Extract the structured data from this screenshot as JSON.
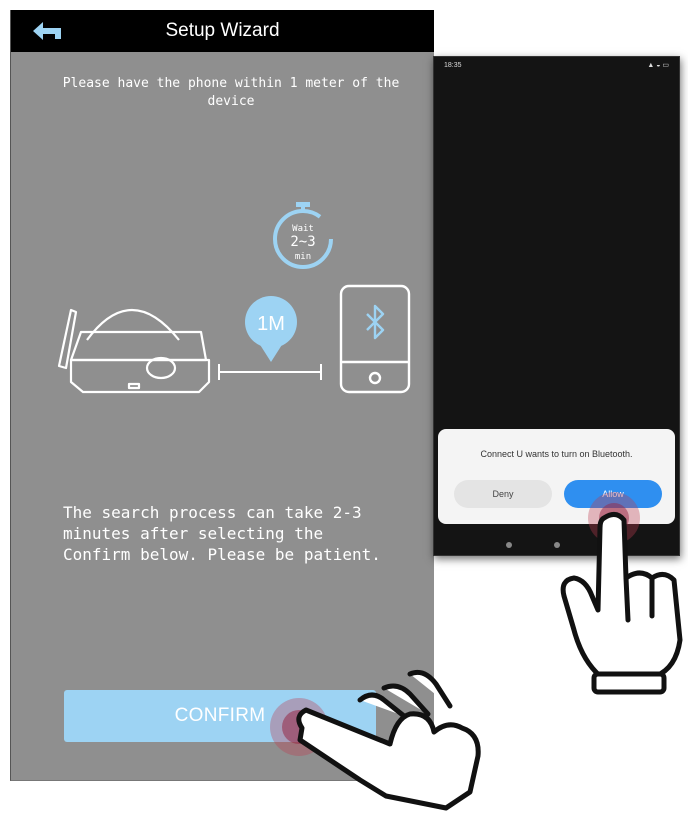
{
  "wizard": {
    "title": "Setup Wizard",
    "instruction": "Please have the phone within 1 meter of the device",
    "wait_line1": "Wait",
    "wait_line2": "2~3",
    "wait_line3": "min",
    "distance_label": "1M",
    "info_text": "The search process can take 2-3\nminutes after selecting the\nConfirm below. Please be patient.",
    "confirm_label": "CONFIRM",
    "accent_color": "#9dd3f3",
    "icons": [
      "back-arrow-icon",
      "timer-icon",
      "router-device-icon",
      "location-pin-icon",
      "phone-icon",
      "bluetooth-icon",
      "tap-hand-icon"
    ]
  },
  "phone": {
    "status_time": "18:35",
    "dialog_message": "Connect U wants to turn on Bluetooth.",
    "deny_label": "Deny",
    "allow_label": "Allow",
    "allow_color": "#2f8ff0"
  }
}
